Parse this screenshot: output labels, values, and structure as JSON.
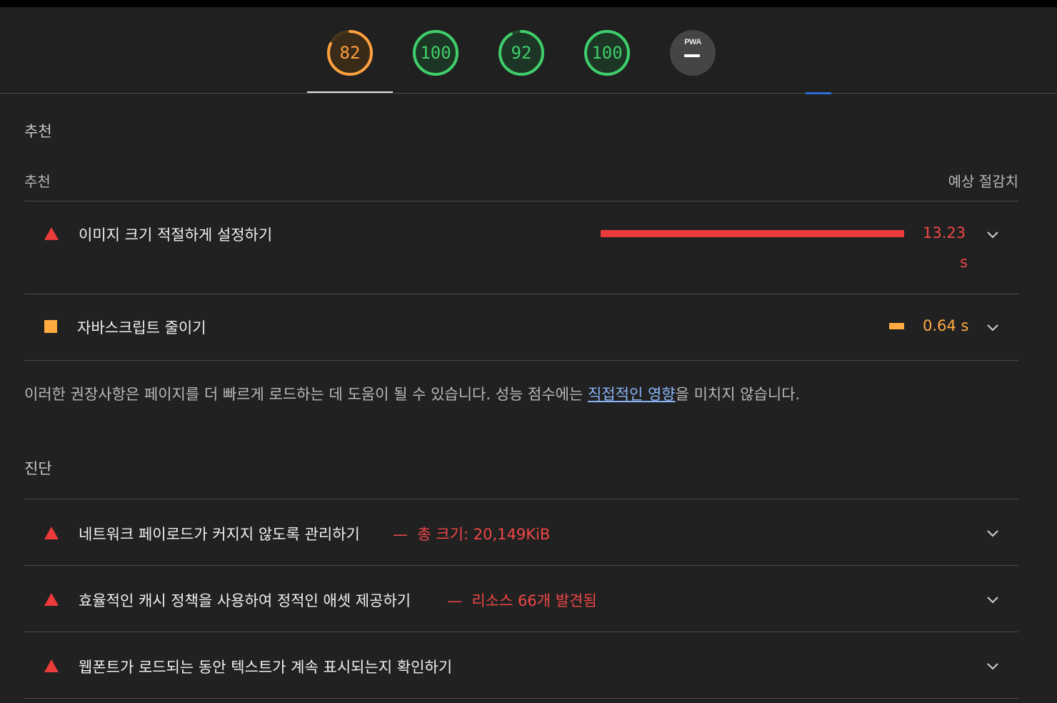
{
  "scores": [
    {
      "label": "82",
      "value": 82,
      "color": "#ffa13f",
      "name": "score-gauge-performance"
    },
    {
      "label": "100",
      "value": 100,
      "color": "#3fce6b",
      "name": "score-gauge-accessibility"
    },
    {
      "label": "92",
      "value": 92,
      "color": "#3fce6b",
      "name": "score-gauge-best-practices"
    },
    {
      "label": "100",
      "value": 100,
      "color": "#3fce6b",
      "name": "score-gauge-seo"
    }
  ],
  "pwa": {
    "label": "PWA",
    "value": "—"
  },
  "opportunities": {
    "section_title": "추천",
    "column_left": "추천",
    "column_right": "예상 절감치",
    "items": [
      {
        "title": "이미지 크기 적절하게 설정하기",
        "savings_line1": "13.23",
        "savings_line2": "s",
        "bar_fraction": 1.0,
        "severity": "fail"
      },
      {
        "title": "자바스크립트 줄이기",
        "savings": "0.64 s",
        "bar_fraction": 0.05,
        "severity": "average"
      }
    ],
    "description_before": "이러한 권장사항은 페이지를 더 빠르게 로드하는 데 도움이 될 수 있습니다. 성능 점수에는 ",
    "description_link": "직접적인 영향",
    "description_after": "을 미치지 않습니다."
  },
  "diagnostics": {
    "section_title": "진단",
    "items": [
      {
        "title": "네트워크 페이로드가 커지지 않도록 관리하기",
        "dash": "—",
        "detail": "총 크기: 20,149KiB",
        "severity": "fail"
      },
      {
        "title": "효율적인 캐시 정책을 사용하여 정적인 애셋 제공하기",
        "dash": "—",
        "detail": "리소스 66개 발견됨",
        "severity": "fail"
      },
      {
        "title": "웹폰트가 로드되는 동안 텍스트가 계속 표시되는지 확인하기",
        "severity": "fail"
      }
    ]
  },
  "colors": {
    "fail": "#eb3b3b",
    "average": "#ffab40",
    "pass": "#3fce6b",
    "background": "#212121"
  }
}
